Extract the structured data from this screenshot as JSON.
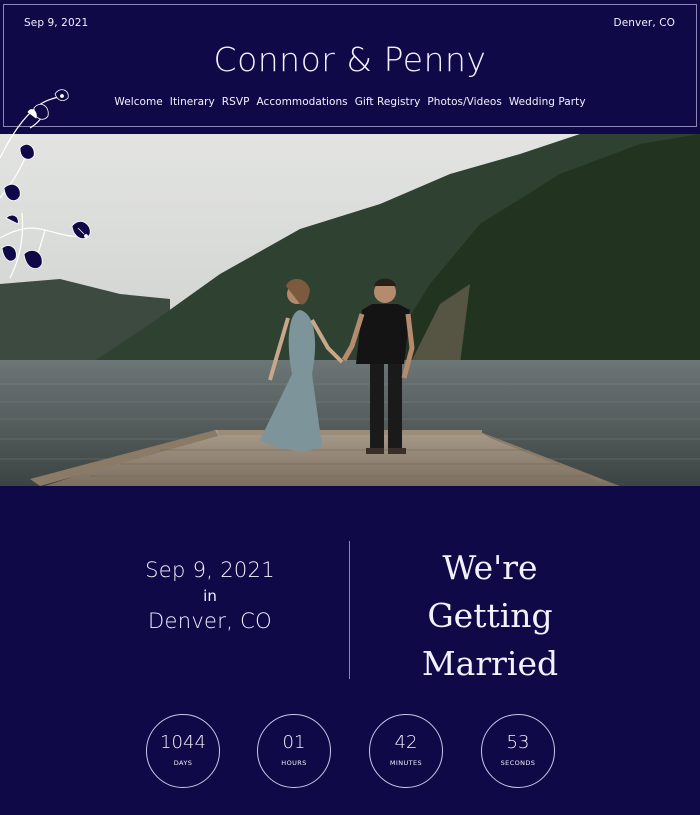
{
  "header": {
    "date": "Sep 9, 2021",
    "location": "Denver, CO",
    "title": "Connor & Penny"
  },
  "nav": {
    "items": [
      "Welcome",
      "Itinerary",
      "RSVP",
      "Accommodations",
      "Gift Registry",
      "Photos/Videos",
      "Wedding Party"
    ]
  },
  "event": {
    "date": "Sep 9, 2021",
    "in": "in",
    "location": "Denver, CO",
    "headline_line1": "We're",
    "headline_line2": "Getting",
    "headline_line3": "Married"
  },
  "countdown": {
    "days": {
      "value": "1044",
      "label": "DAYS"
    },
    "hours": {
      "value": "01",
      "label": "HOURS"
    },
    "minutes": {
      "value": "42",
      "label": "MINUTES"
    },
    "seconds": {
      "value": "53",
      "label": "SECONDS"
    }
  },
  "colors": {
    "background": "#0f0a47",
    "text": "#f3f1ff",
    "border": "#8c87b8"
  }
}
